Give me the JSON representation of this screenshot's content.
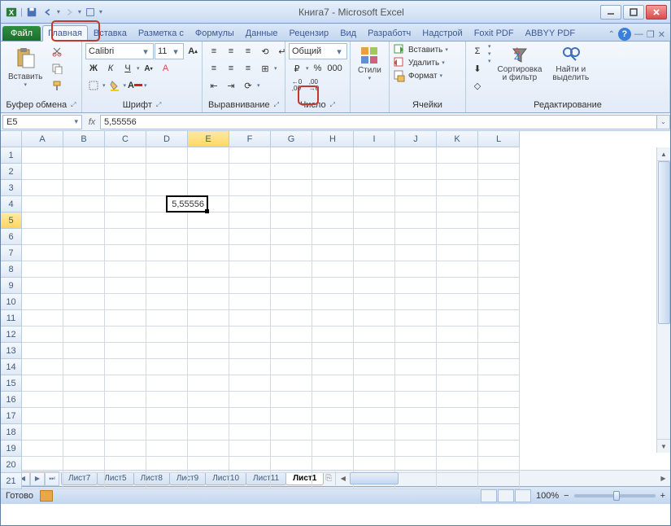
{
  "title": "Книга7  -  Microsoft Excel",
  "qat": {
    "save": "save",
    "undo": "undo",
    "redo": "redo"
  },
  "file_tab": "Файл",
  "tabs": [
    "Главная",
    "Вставка",
    "Разметка с",
    "Формулы",
    "Данные",
    "Рецензир",
    "Вид",
    "Разработч",
    "Надстрой",
    "Foxit PDF",
    "ABBYY PDF"
  ],
  "active_tab": 0,
  "ribbon": {
    "clipboard": {
      "paste": "Вставить",
      "label": "Буфер обмена"
    },
    "font": {
      "name": "Calibri",
      "size": "11",
      "label": "Шрифт",
      "bold": "Ж",
      "italic": "К",
      "underline": "Ч"
    },
    "align": {
      "label": "Выравнивание"
    },
    "number": {
      "format": "Общий",
      "label": "Число"
    },
    "styles": {
      "styles": "Стили"
    },
    "cells": {
      "insert": "Вставить",
      "delete": "Удалить",
      "format": "Формат",
      "label": "Ячейки"
    },
    "editing": {
      "sort": "Сортировка\nи фильтр",
      "find": "Найти и\nвыделить",
      "label": "Редактирование"
    }
  },
  "namebox": "E5",
  "formula": "5,55556",
  "columns": [
    "A",
    "B",
    "C",
    "D",
    "E",
    "F",
    "G",
    "H",
    "I",
    "J",
    "K",
    "L"
  ],
  "selected_col": 4,
  "rows": 21,
  "selected_row": 5,
  "active_cell_value": "5,55556",
  "sheet_nav": [
    "⏮",
    "◀",
    "▶",
    "⏭"
  ],
  "sheets": [
    "Лист7",
    "Лист5",
    "Лист8",
    "Лист9",
    "Лист10",
    "Лист11",
    "Лист1"
  ],
  "active_sheet": 6,
  "status": "Готово",
  "zoom": "100%"
}
